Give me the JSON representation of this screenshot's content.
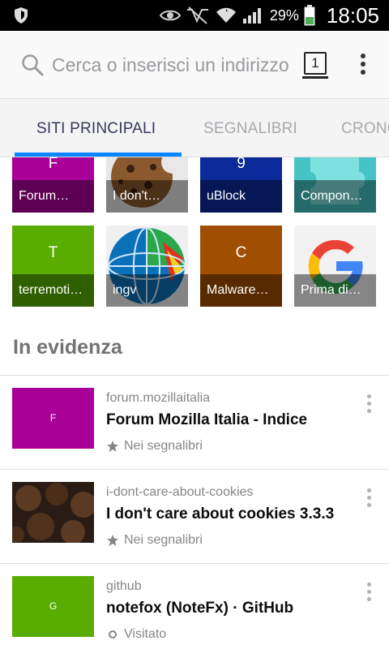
{
  "status_bar": {
    "battery_pct": "29%",
    "time": "18:05",
    "icons": [
      "shield-icon",
      "eye-icon",
      "nfc-mute-icon",
      "wifi-icon",
      "signal-icon",
      "battery-icon"
    ]
  },
  "url_bar": {
    "placeholder": "Cerca o inserisci un indirizzo",
    "tab_count": "1",
    "search_icon": "search-icon",
    "menu_icon": "more-vertical-icon"
  },
  "tabs": [
    {
      "label": "SITI PRINCIPALI",
      "active": true
    },
    {
      "label": "SEGNALIBRI",
      "active": false
    },
    {
      "label": "CRONOLOGIA",
      "active": false
    }
  ],
  "top_sites": [
    {
      "letter": "F",
      "caption": "Forum…",
      "color": "#a90098"
    },
    {
      "letter": "",
      "caption": "I don't…",
      "color": "#cfcfcf",
      "icon": "cookie-icon"
    },
    {
      "letter": "9",
      "caption": "uBlock",
      "color": "#0a2a9a"
    },
    {
      "letter": "",
      "caption": "Compon…",
      "color": "#46c3c4",
      "icon": "puzzle-icon"
    },
    {
      "letter": "T",
      "caption": "terremoti…",
      "color": "#58ad00"
    },
    {
      "letter": "",
      "caption": "ingv",
      "color": "#f0f0f0",
      "icon": "globe-icon"
    },
    {
      "letter": "C",
      "caption": "Malware…",
      "color": "#a04e00"
    },
    {
      "letter": "",
      "caption": "Prima di…",
      "color": "#f2f2f2",
      "icon": "google-icon"
    }
  ],
  "highlights": {
    "title": "In evidenza",
    "items": [
      {
        "domain": "forum.mozillaitalia",
        "title": "Forum Mozilla Italia - Indice",
        "status": "Nei segnalibri",
        "status_icon": "star-icon",
        "thumb_letter": "F",
        "thumb_color": "#a90098"
      },
      {
        "domain": "i-dont-care-about-cookies",
        "title": "I don't care about cookies 3.3.3",
        "status": "Nei segnalibri",
        "status_icon": "star-icon",
        "thumb_letter": "",
        "thumb_color": "#2a1c14"
      },
      {
        "domain": "github",
        "title": "notefox (NoteFx) · GitHub",
        "status": "Visitato",
        "status_icon": "history-dot-icon",
        "thumb_letter": "G",
        "thumb_color": "#58ad00"
      }
    ]
  }
}
